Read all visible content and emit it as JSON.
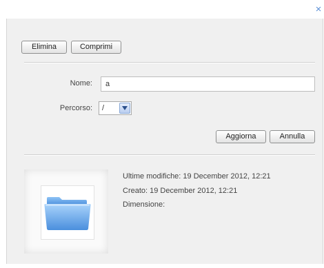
{
  "window": {
    "close_glyph": "×"
  },
  "toolbar": {
    "delete_label": "Elimina",
    "compress_label": "Comprimi"
  },
  "form": {
    "name_label": "Nome:",
    "name_value": "a",
    "path_label": "Percorso:",
    "path_value": "/"
  },
  "actions": {
    "update_label": "Aggiorna",
    "cancel_label": "Annulla"
  },
  "details": {
    "modified": "Ultime modifiche: 19 December 2012, 12:21",
    "created": "Creato: 19 December 2012, 12:21",
    "size": "Dimensione:",
    "thumbnail_icon": "folder-icon"
  },
  "colors": {
    "dialog_bg": "#f0f0f0",
    "close_accent": "#5b8fd6",
    "folder_blue": "#4a8fdd"
  }
}
